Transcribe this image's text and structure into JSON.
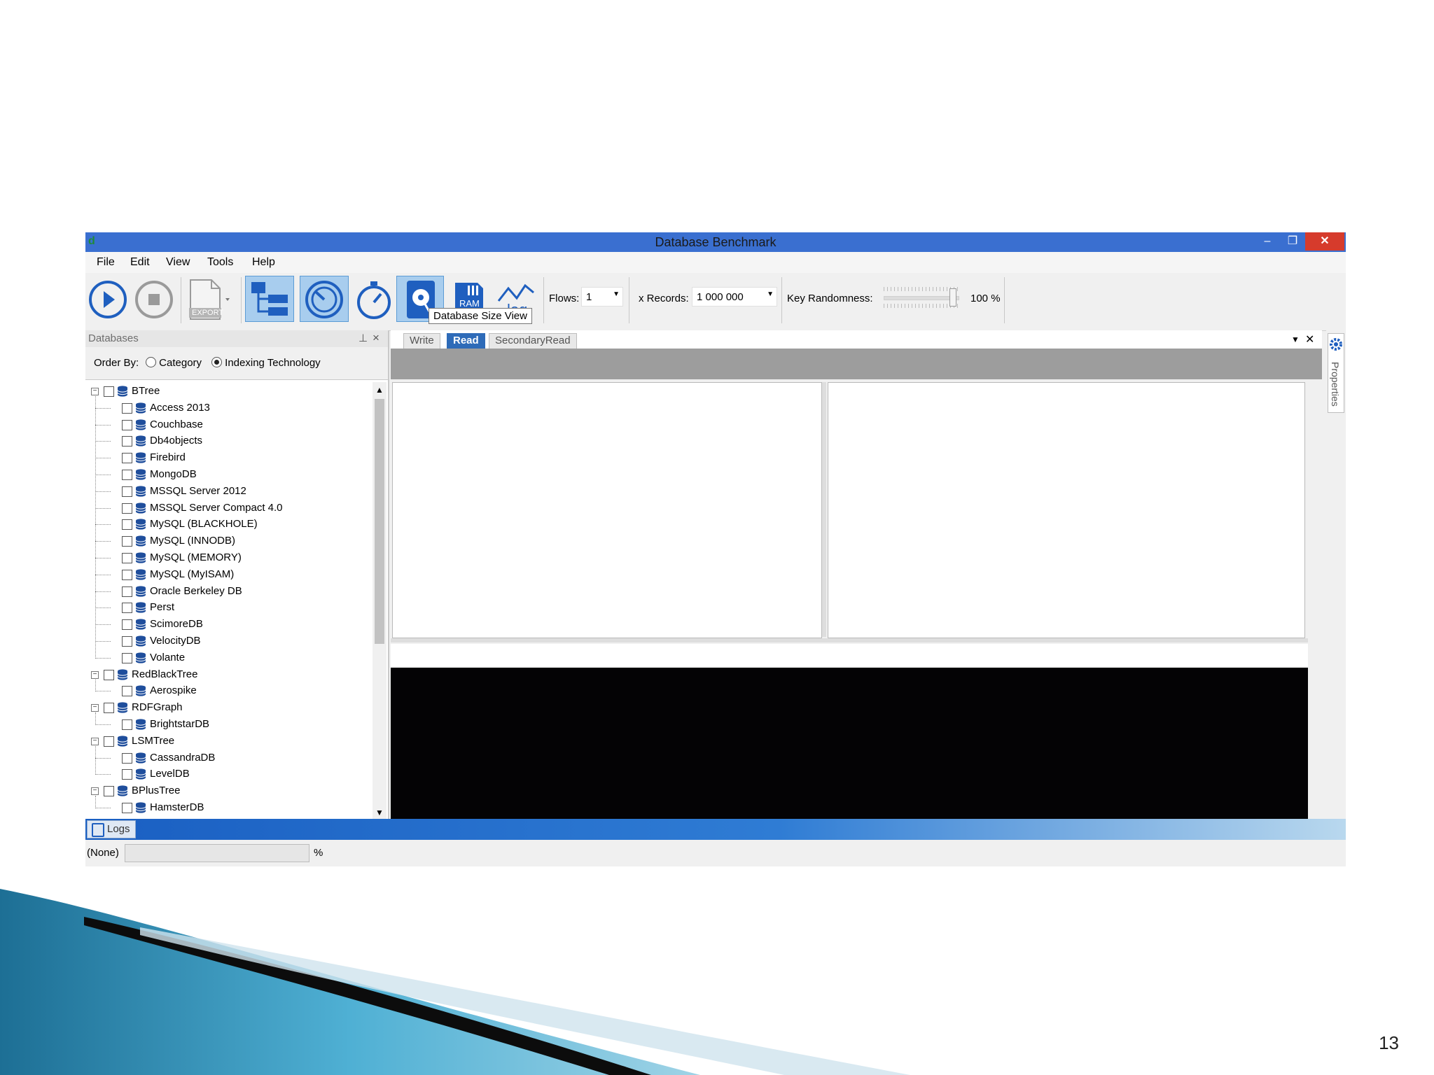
{
  "window": {
    "title": "Database Benchmark",
    "app_glyph": "d"
  },
  "menu": [
    "File",
    "Edit",
    "View",
    "Tools",
    "Help"
  ],
  "toolbar": {
    "export_label": "EXPORT",
    "ram_label": "RAM",
    "log_label": "log",
    "tooltip": "Database Size View",
    "flows_label": "Flows:",
    "flows_value": "1",
    "records_label": "x Records:",
    "records_value": "1 000 000",
    "randomness_label": "Key Randomness:",
    "randomness_value": "100 %",
    "randomness_level": 1.0
  },
  "databases_panel": {
    "title": "Databases",
    "order_by_label": "Order By:",
    "option_category": "Category",
    "option_indexing": "Indexing Technology",
    "selected_option": "Indexing Technology"
  },
  "tree": [
    {
      "label": "BTree",
      "children": [
        "Access 2013",
        "Couchbase",
        "Db4objects",
        "Firebird",
        "MongoDB",
        "MSSQL Server 2012",
        "MSSQL Server Compact 4.0",
        "MySQL (BLACKHOLE)",
        "MySQL (INNODB)",
        "MySQL (MEMORY)",
        "MySQL (MyISAM)",
        "Oracle Berkeley DB",
        "Perst",
        "ScimoreDB",
        "VelocityDB",
        "Volante"
      ]
    },
    {
      "label": "RedBlackTree",
      "children": [
        "Aerospike"
      ]
    },
    {
      "label": "RDFGraph",
      "children": [
        "BrightstarDB"
      ]
    },
    {
      "label": "LSMTree",
      "children": [
        "CassandraDB",
        "LevelDB"
      ]
    },
    {
      "label": "BPlusTree",
      "children": [
        "HamsterDB"
      ]
    }
  ],
  "tabs": [
    {
      "label": "Write",
      "active": false
    },
    {
      "label": "Read",
      "active": true
    },
    {
      "label": "SecondaryRead",
      "active": false
    }
  ],
  "logs_label": "Logs",
  "status": {
    "state": "(None)",
    "percent_symbol": "%"
  },
  "properties_label": "Properties",
  "slide_number": "13",
  "colors": {
    "title_bar": "#3a6fd0",
    "accent_blue": "#1f5fbf",
    "close_red": "#d63b2c",
    "active_tab": "#2e6bb8"
  }
}
